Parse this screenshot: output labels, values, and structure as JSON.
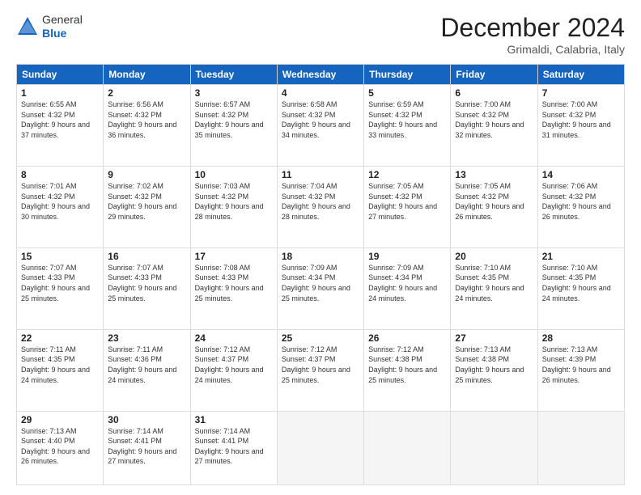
{
  "header": {
    "logo": {
      "line1": "General",
      "line2": "Blue"
    },
    "title": "December 2024",
    "location": "Grimaldi, Calabria, Italy"
  },
  "calendar": {
    "days_of_week": [
      "Sunday",
      "Monday",
      "Tuesday",
      "Wednesday",
      "Thursday",
      "Friday",
      "Saturday"
    ],
    "weeks": [
      [
        {
          "day": "1",
          "sunrise": "Sunrise: 6:55 AM",
          "sunset": "Sunset: 4:32 PM",
          "daylight": "Daylight: 9 hours and 37 minutes."
        },
        {
          "day": "2",
          "sunrise": "Sunrise: 6:56 AM",
          "sunset": "Sunset: 4:32 PM",
          "daylight": "Daylight: 9 hours and 36 minutes."
        },
        {
          "day": "3",
          "sunrise": "Sunrise: 6:57 AM",
          "sunset": "Sunset: 4:32 PM",
          "daylight": "Daylight: 9 hours and 35 minutes."
        },
        {
          "day": "4",
          "sunrise": "Sunrise: 6:58 AM",
          "sunset": "Sunset: 4:32 PM",
          "daylight": "Daylight: 9 hours and 34 minutes."
        },
        {
          "day": "5",
          "sunrise": "Sunrise: 6:59 AM",
          "sunset": "Sunset: 4:32 PM",
          "daylight": "Daylight: 9 hours and 33 minutes."
        },
        {
          "day": "6",
          "sunrise": "Sunrise: 7:00 AM",
          "sunset": "Sunset: 4:32 PM",
          "daylight": "Daylight: 9 hours and 32 minutes."
        },
        {
          "day": "7",
          "sunrise": "Sunrise: 7:00 AM",
          "sunset": "Sunset: 4:32 PM",
          "daylight": "Daylight: 9 hours and 31 minutes."
        }
      ],
      [
        {
          "day": "8",
          "sunrise": "Sunrise: 7:01 AM",
          "sunset": "Sunset: 4:32 PM",
          "daylight": "Daylight: 9 hours and 30 minutes."
        },
        {
          "day": "9",
          "sunrise": "Sunrise: 7:02 AM",
          "sunset": "Sunset: 4:32 PM",
          "daylight": "Daylight: 9 hours and 29 minutes."
        },
        {
          "day": "10",
          "sunrise": "Sunrise: 7:03 AM",
          "sunset": "Sunset: 4:32 PM",
          "daylight": "Daylight: 9 hours and 28 minutes."
        },
        {
          "day": "11",
          "sunrise": "Sunrise: 7:04 AM",
          "sunset": "Sunset: 4:32 PM",
          "daylight": "Daylight: 9 hours and 28 minutes."
        },
        {
          "day": "12",
          "sunrise": "Sunrise: 7:05 AM",
          "sunset": "Sunset: 4:32 PM",
          "daylight": "Daylight: 9 hours and 27 minutes."
        },
        {
          "day": "13",
          "sunrise": "Sunrise: 7:05 AM",
          "sunset": "Sunset: 4:32 PM",
          "daylight": "Daylight: 9 hours and 26 minutes."
        },
        {
          "day": "14",
          "sunrise": "Sunrise: 7:06 AM",
          "sunset": "Sunset: 4:32 PM",
          "daylight": "Daylight: 9 hours and 26 minutes."
        }
      ],
      [
        {
          "day": "15",
          "sunrise": "Sunrise: 7:07 AM",
          "sunset": "Sunset: 4:33 PM",
          "daylight": "Daylight: 9 hours and 25 minutes."
        },
        {
          "day": "16",
          "sunrise": "Sunrise: 7:07 AM",
          "sunset": "Sunset: 4:33 PM",
          "daylight": "Daylight: 9 hours and 25 minutes."
        },
        {
          "day": "17",
          "sunrise": "Sunrise: 7:08 AM",
          "sunset": "Sunset: 4:33 PM",
          "daylight": "Daylight: 9 hours and 25 minutes."
        },
        {
          "day": "18",
          "sunrise": "Sunrise: 7:09 AM",
          "sunset": "Sunset: 4:34 PM",
          "daylight": "Daylight: 9 hours and 25 minutes."
        },
        {
          "day": "19",
          "sunrise": "Sunrise: 7:09 AM",
          "sunset": "Sunset: 4:34 PM",
          "daylight": "Daylight: 9 hours and 24 minutes."
        },
        {
          "day": "20",
          "sunrise": "Sunrise: 7:10 AM",
          "sunset": "Sunset: 4:35 PM",
          "daylight": "Daylight: 9 hours and 24 minutes."
        },
        {
          "day": "21",
          "sunrise": "Sunrise: 7:10 AM",
          "sunset": "Sunset: 4:35 PM",
          "daylight": "Daylight: 9 hours and 24 minutes."
        }
      ],
      [
        {
          "day": "22",
          "sunrise": "Sunrise: 7:11 AM",
          "sunset": "Sunset: 4:35 PM",
          "daylight": "Daylight: 9 hours and 24 minutes."
        },
        {
          "day": "23",
          "sunrise": "Sunrise: 7:11 AM",
          "sunset": "Sunset: 4:36 PM",
          "daylight": "Daylight: 9 hours and 24 minutes."
        },
        {
          "day": "24",
          "sunrise": "Sunrise: 7:12 AM",
          "sunset": "Sunset: 4:37 PM",
          "daylight": "Daylight: 9 hours and 24 minutes."
        },
        {
          "day": "25",
          "sunrise": "Sunrise: 7:12 AM",
          "sunset": "Sunset: 4:37 PM",
          "daylight": "Daylight: 9 hours and 25 minutes."
        },
        {
          "day": "26",
          "sunrise": "Sunrise: 7:12 AM",
          "sunset": "Sunset: 4:38 PM",
          "daylight": "Daylight: 9 hours and 25 minutes."
        },
        {
          "day": "27",
          "sunrise": "Sunrise: 7:13 AM",
          "sunset": "Sunset: 4:38 PM",
          "daylight": "Daylight: 9 hours and 25 minutes."
        },
        {
          "day": "28",
          "sunrise": "Sunrise: 7:13 AM",
          "sunset": "Sunset: 4:39 PM",
          "daylight": "Daylight: 9 hours and 26 minutes."
        }
      ],
      [
        {
          "day": "29",
          "sunrise": "Sunrise: 7:13 AM",
          "sunset": "Sunset: 4:40 PM",
          "daylight": "Daylight: 9 hours and 26 minutes."
        },
        {
          "day": "30",
          "sunrise": "Sunrise: 7:14 AM",
          "sunset": "Sunset: 4:41 PM",
          "daylight": "Daylight: 9 hours and 27 minutes."
        },
        {
          "day": "31",
          "sunrise": "Sunrise: 7:14 AM",
          "sunset": "Sunset: 4:41 PM",
          "daylight": "Daylight: 9 hours and 27 minutes."
        },
        null,
        null,
        null,
        null
      ]
    ]
  }
}
